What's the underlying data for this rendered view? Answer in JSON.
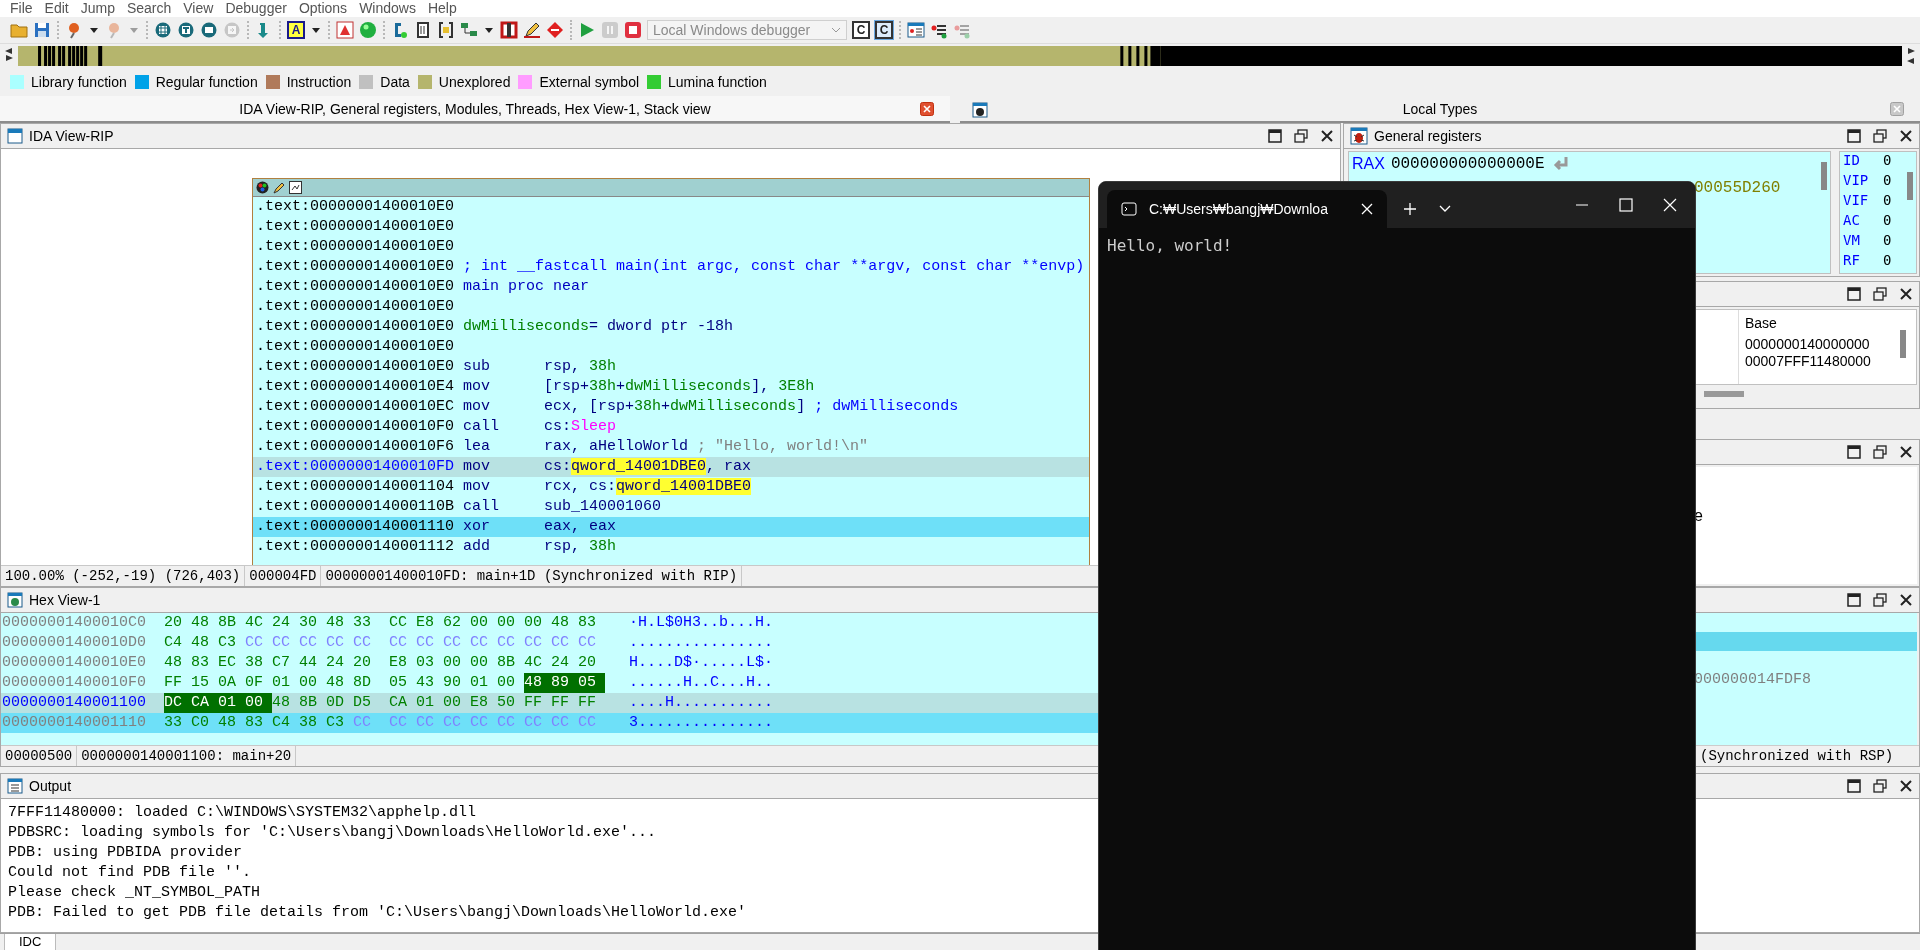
{
  "menu": [
    "File",
    "Edit",
    "Jump",
    "Search",
    "View",
    "Debugger",
    "Options",
    "Windows",
    "Help"
  ],
  "toolbar": {
    "groups": [
      [
        {
          "kind": "folder",
          "disabled": false
        },
        {
          "kind": "floppy",
          "disabled": false
        }
      ],
      [
        {
          "kind": "pin",
          "disabled": false
        },
        {
          "kind": "caret",
          "disabled": false
        },
        {
          "kind": "pin",
          "disabled": true
        },
        {
          "kind": "caret",
          "disabled": true
        }
      ],
      [
        {
          "kind": "circle-grid",
          "disabled": false
        },
        {
          "kind": "circle-dot",
          "disabled": false
        },
        {
          "kind": "circle-box",
          "disabled": false
        },
        {
          "kind": "circle-arrow",
          "disabled": true
        }
      ],
      [
        {
          "kind": "arrow-down",
          "disabled": false
        }
      ],
      [
        {
          "kind": "letter-box",
          "label": "A",
          "disabled": false
        },
        {
          "kind": "caret",
          "disabled": false
        }
      ],
      [
        {
          "kind": "triangle-box",
          "disabled": false
        },
        {
          "kind": "green-ball",
          "disabled": false
        }
      ],
      [
        {
          "kind": "plugin",
          "disabled": false
        },
        {
          "kind": "document",
          "disabled": false
        },
        {
          "kind": "bracket",
          "disabled": false
        },
        {
          "kind": "graph",
          "disabled": false
        },
        {
          "kind": "caret",
          "disabled": false
        },
        {
          "kind": "red-frame",
          "disabled": false
        },
        {
          "kind": "pencil",
          "disabled": false
        },
        {
          "kind": "stop-sign",
          "disabled": false
        }
      ],
      [
        {
          "kind": "play",
          "disabled": false
        },
        {
          "kind": "pause",
          "disabled": true
        },
        {
          "kind": "stop",
          "disabled": false
        },
        {
          "kind": "debugger-select",
          "label": "Local Windows debugger",
          "disabled": true
        },
        {
          "kind": "letter-box-c",
          "label": "C",
          "disabled": false
        },
        {
          "kind": "letter-box-c",
          "label": "C",
          "disabled": false,
          "selected": true
        }
      ],
      [
        {
          "kind": "list-window",
          "disabled": false
        },
        {
          "kind": "list-red",
          "disabled": false
        },
        {
          "kind": "list-red",
          "disabled": true
        }
      ]
    ]
  },
  "legend": [
    {
      "label": "Library function",
      "color": "#aaffff"
    },
    {
      "label": "Regular function",
      "color": "#00a2e8"
    },
    {
      "label": "Instruction",
      "color": "#b07a5a"
    },
    {
      "label": "Data",
      "color": "#c0c0c0"
    },
    {
      "label": "Unexplored",
      "color": "#b5b56d"
    },
    {
      "label": "External symbol",
      "color": "#ff9cff"
    },
    {
      "label": "Lumina function",
      "color": "#33cc33"
    }
  ],
  "dock_tabs": [
    {
      "label": "IDA View-RIP, General registers, Modules, Threads, Hex View-1, Stack view",
      "selected": true
    },
    {
      "label": "Local Types",
      "selected": false
    }
  ],
  "ida_view": {
    "title": "IDA View-RIP",
    "lines": [
      {
        "address": ".text:00000001400010E0",
        "selected": false,
        "at_ip": false
      },
      {
        "address": ".text:00000001400010E0",
        "selected": false,
        "at_ip": false
      },
      {
        "address": ".text:00000001400010E0",
        "selected": false,
        "at_ip": false
      },
      {
        "address": ".text:00000001400010E0",
        "tokens": [
          {
            "text": "; int __fastcall main(int argc, const char **argv, const char **envp)",
            "kind": "comment"
          }
        ],
        "selected": false,
        "at_ip": false
      },
      {
        "address": ".text:00000001400010E0",
        "tokens": [
          {
            "text": "main proc near",
            "kind": "label"
          }
        ],
        "selected": false,
        "at_ip": false
      },
      {
        "address": ".text:00000001400010E0",
        "selected": false,
        "at_ip": false
      },
      {
        "address": ".text:00000001400010E0",
        "tokens": [
          {
            "text": "dwMilliseconds",
            "kind": "variable"
          },
          {
            "text": "= dword ptr -18h",
            "kind": "plain"
          }
        ],
        "selected": false,
        "at_ip": false
      },
      {
        "address": ".text:00000001400010E0",
        "selected": false,
        "at_ip": false
      },
      {
        "address": ".text:00000001400010E0",
        "mnemonic": "sub",
        "tokens": [
          {
            "text": "rsp, ",
            "kind": "plain"
          },
          {
            "text": "38h",
            "kind": "number"
          }
        ],
        "selected": false,
        "at_ip": false
      },
      {
        "address": ".text:00000001400010E4",
        "mnemonic": "mov",
        "tokens": [
          {
            "text": "[rsp+",
            "kind": "plain"
          },
          {
            "text": "38h",
            "kind": "number"
          },
          {
            "text": "+",
            "kind": "plain"
          },
          {
            "text": "dwMilliseconds",
            "kind": "variable"
          },
          {
            "text": "], ",
            "kind": "plain"
          },
          {
            "text": "3E8h",
            "kind": "number"
          }
        ],
        "selected": false,
        "at_ip": false
      },
      {
        "address": ".text:00000001400010EC",
        "mnemonic": "mov",
        "tokens": [
          {
            "text": "ecx, [rsp+",
            "kind": "plain"
          },
          {
            "text": "38h",
            "kind": "number"
          },
          {
            "text": "+",
            "kind": "plain"
          },
          {
            "text": "dwMilliseconds",
            "kind": "variable"
          },
          {
            "text": "] ",
            "kind": "plain"
          },
          {
            "text": "; dwMilliseconds",
            "kind": "comment"
          }
        ],
        "selected": false,
        "at_ip": false
      },
      {
        "address": ".text:00000001400010F0",
        "mnemonic": "call",
        "tokens": [
          {
            "text": "cs:",
            "kind": "plain"
          },
          {
            "text": "Sleep",
            "kind": "import"
          }
        ],
        "selected": false,
        "at_ip": false
      },
      {
        "address": ".text:00000001400010F6",
        "mnemonic": "lea",
        "tokens": [
          {
            "text": "rax, aHelloWorld ",
            "kind": "plain"
          },
          {
            "text": "; \"Hello, world!\\n\"",
            "kind": "string"
          }
        ],
        "selected": false,
        "at_ip": false
      },
      {
        "address": ".text:00000001400010FD",
        "mnemonic": "mov",
        "tokens": [
          {
            "text": "cs:",
            "kind": "plain"
          },
          {
            "text": "qword_14001DBE0",
            "kind": "highlight"
          },
          {
            "text": ", rax",
            "kind": "plain"
          }
        ],
        "selected": true,
        "at_ip": false
      },
      {
        "address": ".text:0000000140001104",
        "mnemonic": "mov",
        "tokens": [
          {
            "text": "rcx, cs:",
            "kind": "plain"
          },
          {
            "text": "qword_14001DBE0",
            "kind": "highlight"
          }
        ],
        "selected": false,
        "at_ip": false
      },
      {
        "address": ".text:000000014000110B",
        "mnemonic": "call",
        "tokens": [
          {
            "text": "sub_140001060",
            "kind": "plain"
          }
        ],
        "selected": false,
        "at_ip": false
      },
      {
        "address": ".text:0000000140001110",
        "mnemonic": "xor",
        "tokens": [
          {
            "text": "eax, eax",
            "kind": "plain"
          }
        ],
        "selected": false,
        "at_ip": true
      },
      {
        "address": ".text:0000000140001112",
        "mnemonic": "add",
        "tokens": [
          {
            "text": "rsp, ",
            "kind": "plain"
          },
          {
            "text": "38h",
            "kind": "number"
          }
        ],
        "selected": false,
        "at_ip": false
      }
    ],
    "status": [
      "100.00% (-252,-19) (726,403)",
      "000004FD",
      "00000001400010FD: main+1D (Synchronized with RIP)"
    ]
  },
  "registers": {
    "title": "General registers",
    "rows": [
      {
        "name": "RAX",
        "value": "000000000000000E",
        "kind": "full"
      },
      {
        "value": "00055D260",
        "kind": "partial"
      }
    ],
    "flags": [
      {
        "name": "ID",
        "value": "0"
      },
      {
        "name": "VIP",
        "value": "0"
      },
      {
        "name": "VIF",
        "value": "0"
      },
      {
        "name": "AC",
        "value": "0"
      },
      {
        "name": "VM",
        "value": "0"
      },
      {
        "name": "RF",
        "value": "0"
      }
    ]
  },
  "modules": {
    "columns": [
      "Base"
    ],
    "rows": [
      "0000000140000000",
      "00007FFF11480000"
    ]
  },
  "threads": {
    "visible_text": "e"
  },
  "hex_view": {
    "title": "Hex View-1",
    "rows": [
      {
        "address": "00000001400010C0",
        "bytes": [
          {
            "text": "20",
            "kind": "code",
            "selected": false
          },
          {
            "text": "48",
            "kind": "code",
            "selected": false
          },
          {
            "text": "8B",
            "kind": "code",
            "selected": false
          },
          {
            "text": "4C",
            "kind": "code",
            "selected": false
          },
          {
            "text": "24",
            "kind": "code",
            "selected": false
          },
          {
            "text": "30",
            "kind": "code",
            "selected": false
          },
          {
            "text": "48",
            "kind": "code",
            "selected": false
          },
          {
            "text": "33",
            "kind": "code",
            "selected": false
          },
          {
            "text": "CC",
            "kind": "code",
            "selected": false
          },
          {
            "text": "E8",
            "kind": "code",
            "selected": false
          },
          {
            "text": "62",
            "kind": "code",
            "selected": false
          },
          {
            "text": "00",
            "kind": "code",
            "selected": false
          },
          {
            "text": "00",
            "kind": "code",
            "selected": false
          },
          {
            "text": "00",
            "kind": "code",
            "selected": false
          },
          {
            "text": "48",
            "kind": "code",
            "selected": false
          },
          {
            "text": "83",
            "kind": "code",
            "selected": false
          }
        ],
        "ascii": "·H.L$0H3..b...H.",
        "selected": false,
        "at_ip": false
      },
      {
        "address": "00000001400010D0",
        "bytes": [
          {
            "text": "C4",
            "kind": "code",
            "selected": false
          },
          {
            "text": "48",
            "kind": "code",
            "selected": false
          },
          {
            "text": "C3",
            "kind": "code",
            "selected": false
          },
          {
            "text": "CC",
            "kind": "filler",
            "selected": false
          },
          {
            "text": "CC",
            "kind": "filler",
            "selected": false
          },
          {
            "text": "CC",
            "kind": "filler",
            "selected": false
          },
          {
            "text": "CC",
            "kind": "filler",
            "selected": false
          },
          {
            "text": "CC",
            "kind": "filler",
            "selected": false
          },
          {
            "text": "CC",
            "kind": "filler",
            "selected": false
          },
          {
            "text": "CC",
            "kind": "filler",
            "selected": false
          },
          {
            "text": "CC",
            "kind": "filler",
            "selected": false
          },
          {
            "text": "CC",
            "kind": "filler",
            "selected": false
          },
          {
            "text": "CC",
            "kind": "filler",
            "selected": false
          },
          {
            "text": "CC",
            "kind": "filler",
            "selected": false
          },
          {
            "text": "CC",
            "kind": "filler",
            "selected": false
          },
          {
            "text": "CC",
            "kind": "filler",
            "selected": false
          }
        ],
        "ascii": "................",
        "selected": false,
        "at_ip": false
      },
      {
        "address": "00000001400010E0",
        "bytes": [
          {
            "text": "48",
            "kind": "code",
            "selected": false
          },
          {
            "text": "83",
            "kind": "code",
            "selected": false
          },
          {
            "text": "EC",
            "kind": "code",
            "selected": false
          },
          {
            "text": "38",
            "kind": "code",
            "selected": false
          },
          {
            "text": "C7",
            "kind": "code",
            "selected": false
          },
          {
            "text": "44",
            "kind": "code",
            "selected": false
          },
          {
            "text": "24",
            "kind": "code",
            "selected": false
          },
          {
            "text": "20",
            "kind": "code",
            "selected": false
          },
          {
            "text": "E8",
            "kind": "code",
            "selected": false
          },
          {
            "text": "03",
            "kind": "code",
            "selected": false
          },
          {
            "text": "00",
            "kind": "code",
            "selected": false
          },
          {
            "text": "00",
            "kind": "code",
            "selected": false
          },
          {
            "text": "8B",
            "kind": "code",
            "selected": false
          },
          {
            "text": "4C",
            "kind": "code",
            "selected": false
          },
          {
            "text": "24",
            "kind": "code",
            "selected": false
          },
          {
            "text": "20",
            "kind": "code",
            "selected": false
          }
        ],
        "ascii": "H....D$·.....L$·",
        "selected": false,
        "at_ip": false
      },
      {
        "address": "00000001400010F0",
        "bytes": [
          {
            "text": "FF",
            "kind": "code",
            "selected": false
          },
          {
            "text": "15",
            "kind": "code",
            "selected": false
          },
          {
            "text": "0A",
            "kind": "code",
            "selected": false
          },
          {
            "text": "0F",
            "kind": "code",
            "selected": false
          },
          {
            "text": "01",
            "kind": "code",
            "selected": false
          },
          {
            "text": "00",
            "kind": "code",
            "selected": false
          },
          {
            "text": "48",
            "kind": "code",
            "selected": false
          },
          {
            "text": "8D",
            "kind": "code",
            "selected": false
          },
          {
            "text": "05",
            "kind": "code",
            "selected": false
          },
          {
            "text": "43",
            "kind": "code",
            "selected": false
          },
          {
            "text": "90",
            "kind": "code",
            "selected": false
          },
          {
            "text": "01",
            "kind": "code",
            "selected": false
          },
          {
            "text": "00",
            "kind": "code",
            "selected": false
          },
          {
            "text": "48",
            "kind": "code",
            "selected": true
          },
          {
            "text": "89",
            "kind": "code",
            "selected": true
          },
          {
            "text": "05",
            "kind": "code",
            "selected": true
          }
        ],
        "ascii": "......H..C...H..",
        "selected": false,
        "at_ip": false
      },
      {
        "address": "0000000140001100",
        "bytes": [
          {
            "text": "DC",
            "kind": "code",
            "selected": true
          },
          {
            "text": "CA",
            "kind": "code",
            "selected": true
          },
          {
            "text": "01",
            "kind": "code",
            "selected": true
          },
          {
            "text": "00",
            "kind": "code",
            "selected": true
          },
          {
            "text": "48",
            "kind": "code",
            "selected": false
          },
          {
            "text": "8B",
            "kind": "code",
            "selected": false
          },
          {
            "text": "0D",
            "kind": "code",
            "selected": false
          },
          {
            "text": "D5",
            "kind": "code",
            "selected": false
          },
          {
            "text": "CA",
            "kind": "code",
            "selected": false
          },
          {
            "text": "01",
            "kind": "code",
            "selected": false
          },
          {
            "text": "00",
            "kind": "code",
            "selected": false
          },
          {
            "text": "E8",
            "kind": "code",
            "selected": false
          },
          {
            "text": "50",
            "kind": "code",
            "selected": false
          },
          {
            "text": "FF",
            "kind": "code",
            "selected": false
          },
          {
            "text": "FF",
            "kind": "code",
            "selected": false
          },
          {
            "text": "FF",
            "kind": "code",
            "selected": false
          }
        ],
        "ascii": "....H...........",
        "selected": true,
        "at_ip": false
      },
      {
        "address": "0000000140001110",
        "bytes": [
          {
            "text": "33",
            "kind": "code",
            "selected": false
          },
          {
            "text": "C0",
            "kind": "code",
            "selected": false
          },
          {
            "text": "48",
            "kind": "code",
            "selected": false
          },
          {
            "text": "83",
            "kind": "code",
            "selected": false
          },
          {
            "text": "C4",
            "kind": "code",
            "selected": false
          },
          {
            "text": "38",
            "kind": "code",
            "selected": false
          },
          {
            "text": "C3",
            "kind": "code",
            "selected": false
          },
          {
            "text": "CC",
            "kind": "filler",
            "selected": false
          },
          {
            "text": "CC",
            "kind": "filler",
            "selected": false
          },
          {
            "text": "CC",
            "kind": "filler",
            "selected": false
          },
          {
            "text": "CC",
            "kind": "filler",
            "selected": false
          },
          {
            "text": "CC",
            "kind": "filler",
            "selected": false
          },
          {
            "text": "CC",
            "kind": "filler",
            "selected": false
          },
          {
            "text": "CC",
            "kind": "filler",
            "selected": false
          },
          {
            "text": "CC",
            "kind": "filler",
            "selected": false
          },
          {
            "text": "CC",
            "kind": "filler",
            "selected": false
          }
        ],
        "ascii": "3...............",
        "selected": false,
        "at_ip": true
      }
    ],
    "status": [
      "00000500",
      "0000000140001100: main+20"
    ]
  },
  "stack_view": {
    "rows": [
      {
        "selected": false
      },
      {
        "selected": true
      },
      {
        "selected": false
      },
      {
        "value": "000000014FDF8",
        "selected": false
      }
    ],
    "status": "(Synchronized with RSP)"
  },
  "output": {
    "title": "Output",
    "lines": [
      "7FFF11480000: loaded C:\\WINDOWS\\SYSTEM32\\apphelp.dll",
      "PDBSRC: loading symbols for 'C:\\Users\\bangj\\Downloads\\HelloWorld.exe'...",
      "PDB: using PDBIDA provider",
      "Could not find PDB file ''.",
      "Please check _NT_SYMBOL_PATH",
      "PDB: Failed to get PDB file details from 'C:\\Users\\bangj\\Downloads\\HelloWorld.exe'"
    ]
  },
  "bottom_tabs": [
    {
      "label": "IDC",
      "selected": true
    }
  ],
  "terminal": {
    "tab_title": "C:₩Users₩bangj₩Downloa",
    "output": "Hello, world!"
  }
}
